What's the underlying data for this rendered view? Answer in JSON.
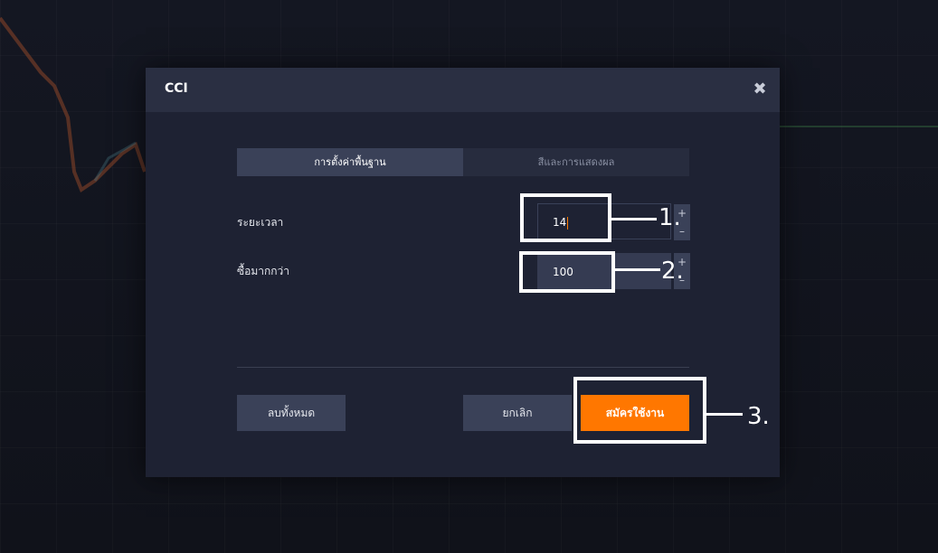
{
  "dialog": {
    "title": "CCI",
    "close_symbol": "✖"
  },
  "tabs": [
    {
      "label": "การตั้งค่าพื้นฐาน",
      "active": true
    },
    {
      "label": "สีและการแสดงผล",
      "active": false
    }
  ],
  "fields": {
    "period": {
      "label": "ระยะเวลา",
      "value": "14"
    },
    "overbought": {
      "label": "ซื้อมากกว่า",
      "value": "100"
    }
  },
  "stepper": {
    "plus": "+",
    "minus": "–"
  },
  "buttons": {
    "reset": "ลบทั้งหมด",
    "cancel": "ยกเลิก",
    "apply": "สมัครใช้งาน"
  },
  "annotations": {
    "step1": "1.",
    "step2": "2.",
    "step3": "3."
  },
  "colors": {
    "accent": "#ff7700",
    "highlight": "#ffffff"
  }
}
